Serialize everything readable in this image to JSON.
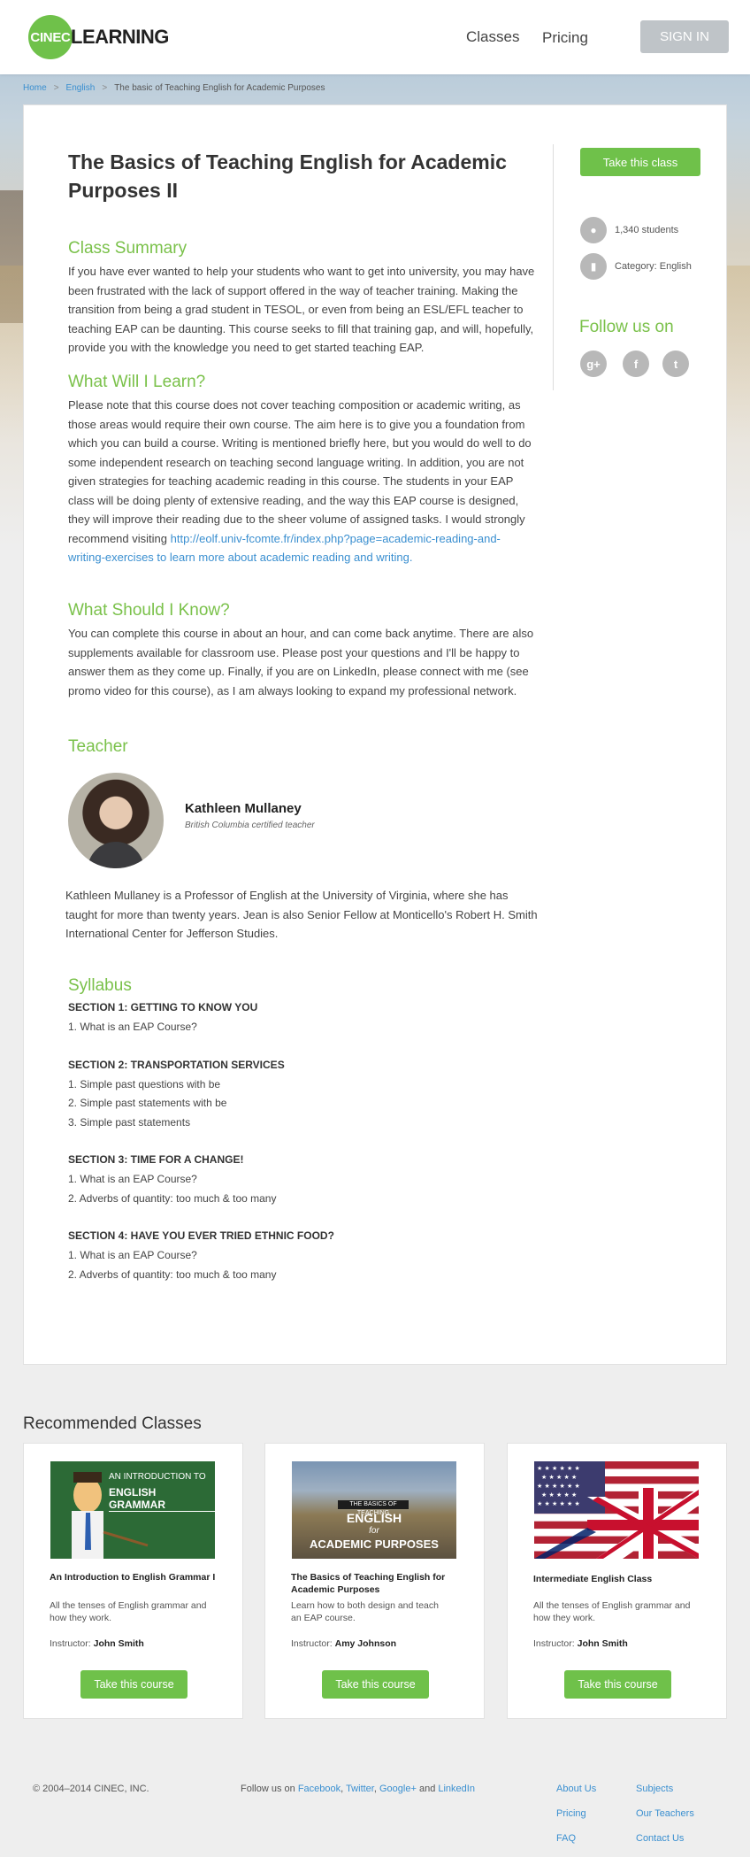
{
  "header": {
    "logo_badge": "CINEC",
    "logo_word": "LEARNING",
    "nav": [
      "Classes",
      "Pricing"
    ],
    "signin_label": "SIGN IN"
  },
  "breadcrumb": {
    "home": "Home",
    "category": "English",
    "current": "The basic of Teaching English for Academic Purposes",
    "separator": ">"
  },
  "course": {
    "title": "The Basics of Teaching English for Academic Purposes II",
    "summary_heading": "Class Summary",
    "summary": "If you have ever wanted to help your students who want to get into university, you may have been frustrated with the lack of support offered in the way of teacher training. Making the transition from being a grad student in TESOL, or even from being an ESL/EFL teacher to teaching EAP can be daunting. This course seeks to fill that training gap, and will, hopefully, provide you with the knowledge you need to get started teaching EAP.",
    "learn_heading": "What Will I Learn?",
    "learn_text": "Please note that this course does not cover teaching composition or academic writing, as those areas would require their own course. The aim here is to give you a foundation from which you can build a course. Writing is mentioned briefly here, but you would do well to do some independent research on teaching second language writing. In addition, you are not given strategies for teaching academic reading in this course. The students in your EAP class will be doing plenty of extensive reading, and the way this EAP course is designed, they will improve their reading due to the sheer volume of assigned tasks. I would strongly recommend visiting",
    "learn_link": "http://eolf.univ-fcomte.fr/index.php?page=academic-reading-and-writing-exercises to learn more about academic reading and writing.",
    "know_heading": "What Should I Know?",
    "know_text": "You can complete this course in about an hour, and can come back anytime. There are also supplements available for classroom use. Please post your questions and I'll be happy to answer them as they come up. Finally, if you are on LinkedIn, please connect with me (see promo video for this course), as I am always looking to expand my professional network.",
    "teacher_heading": "Teacher",
    "teacher_name": "Kathleen Mullaney",
    "teacher_subtitle": "British Columbia certified teacher",
    "teacher_bio": "Kathleen Mullaney is a Professor of English at the University of Virginia, where she has taught for more than twenty years. Jean is also Senior Fellow at Monticello's Robert H. Smith International Center for Jefferson Studies.",
    "syllabus_heading": "Syllabus",
    "syllabus": [
      {
        "section": "SECTION 1: GETTING TO KNOW YOU",
        "items": [
          "1. What is an EAP Course?"
        ]
      },
      {
        "section": "SECTION 2: TRANSPORTATION SERVICES",
        "items": [
          "1. Simple past questions with be",
          "2. Simple past statements with be",
          "3. Simple past statements"
        ]
      },
      {
        "section": "SECTION 3: TIME FOR A CHANGE!",
        "items": [
          "1. What is an EAP Course?",
          "2. Adverbs of quantity: too much & too many"
        ]
      },
      {
        "section": "SECTION 4: HAVE YOU EVER TRIED ETHNIC FOOD?",
        "items": [
          "1. What is an EAP Course?",
          "2. Adverbs of quantity: too much & too many"
        ]
      }
    ]
  },
  "sidebar": {
    "take_label": "Take this class",
    "students": "1,340 students",
    "category": "Category: English",
    "follow_heading": "Follow us on",
    "social_icons": [
      "google-plus-icon",
      "facebook-icon",
      "twitter-icon"
    ]
  },
  "recommended": {
    "heading": "Recommended Classes",
    "cards": [
      {
        "img_line1": "AN INTRODUCTION TO",
        "img_line2": "ENGLISH GRAMMAR",
        "name": "An Introduction to English Grammar I",
        "desc": "All the tenses of English grammar and how they work.",
        "instructor_label": "Instructor:",
        "instructor": "John Smith",
        "button": "Take this course"
      },
      {
        "img_line1": "THE BASICS OF TEACHING",
        "img_line2": "ENGLISH",
        "img_line3": "for",
        "img_line4": "ACADEMIC PURPOSES",
        "name": "The Basics of Teaching English for Academic Purposes",
        "desc": "Learn how to both design and teach an EAP course.",
        "instructor_label": "Instructor:",
        "instructor": "Amy Johnson",
        "button": "Take this course"
      },
      {
        "name": "Intermediate English Class",
        "desc": "All the tenses of English grammar and how they work.",
        "instructor_label": "Instructor:",
        "instructor": "John Smith",
        "button": "Take this course"
      }
    ]
  },
  "footer": {
    "copyright": "© 2004–2014 CINEC, INC.",
    "follow_prefix": "Follow us on",
    "follow_links": [
      "Facebook",
      "Twitter",
      "Google+",
      "LinkedIn"
    ],
    "follow_and": "and",
    "links": [
      "About Us",
      "Subjects",
      "Pricing",
      "Our Teachers",
      "FAQ",
      "Contact Us"
    ]
  },
  "colors": {
    "accent_green": "#6fc14a",
    "link_blue": "#3a8fd0",
    "icon_gray": "#b8b8b8"
  }
}
